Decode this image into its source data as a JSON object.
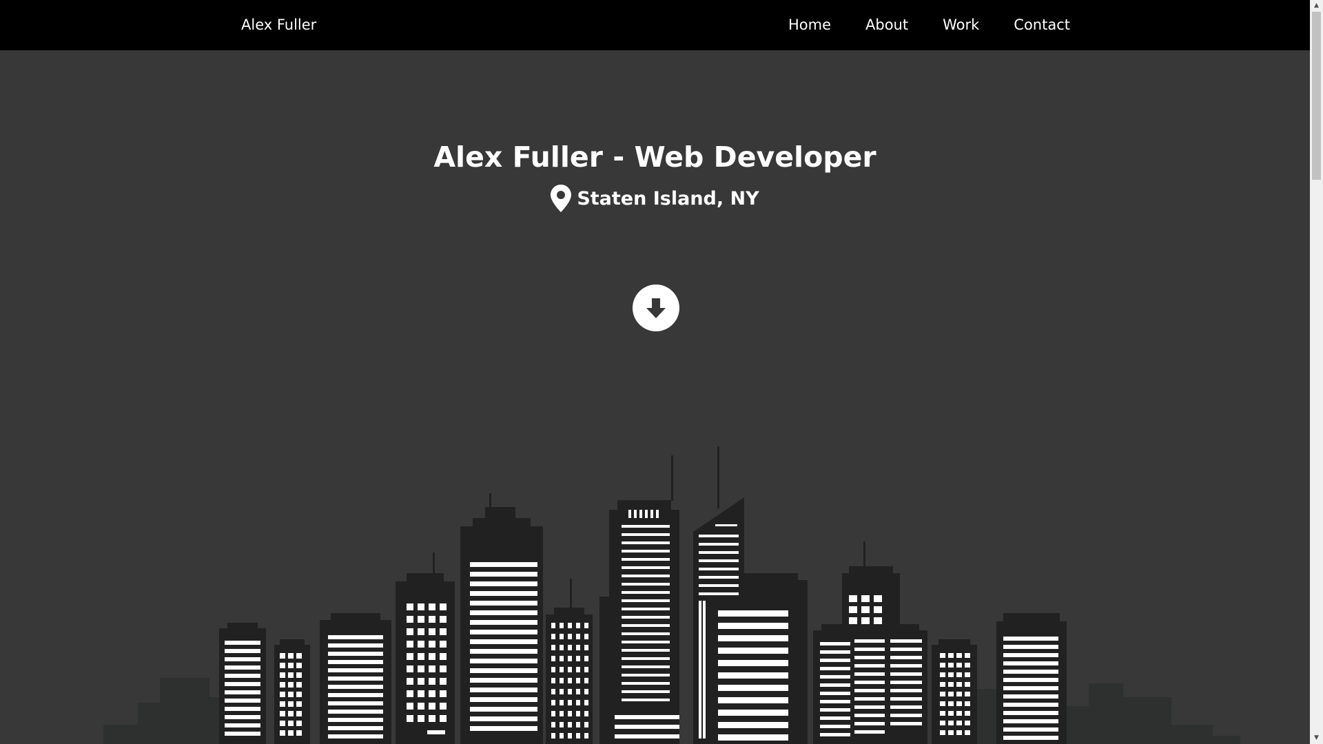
{
  "header": {
    "brand": "Alex Fuller",
    "nav": [
      "Home",
      "About",
      "Work",
      "Contact"
    ]
  },
  "hero": {
    "title": "Alex Fuller - Web Developer",
    "location": "Staten Island, NY"
  },
  "icons": {
    "location": "map-pin-icon",
    "scroll_down": "arrow-circle-down-icon"
  },
  "colors": {
    "navbar": "#000000",
    "background": "#383838",
    "text": "#ffffff",
    "buildings": "#222121",
    "background_buildings": "#2e2f2f"
  }
}
